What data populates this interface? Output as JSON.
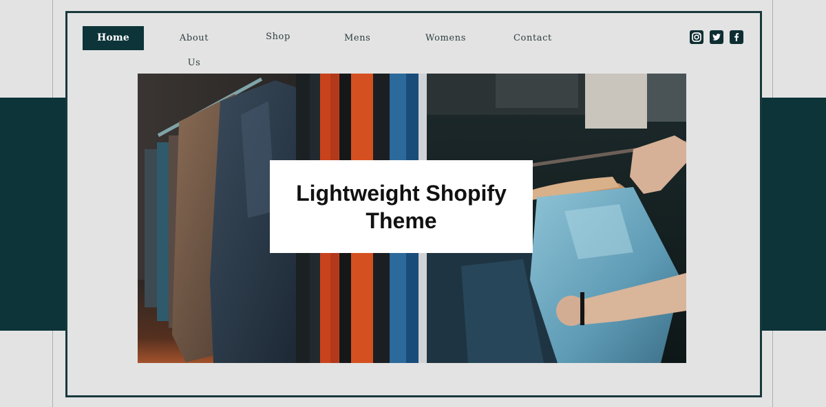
{
  "nav": {
    "items": [
      {
        "label": "Home",
        "active": true
      },
      {
        "label": "About Us",
        "active": false
      },
      {
        "label": "Shop",
        "active": false
      },
      {
        "label": "Mens",
        "active": false
      },
      {
        "label": "Womens",
        "active": false
      },
      {
        "label": "Contact",
        "active": false
      }
    ]
  },
  "social": {
    "icons": [
      "instagram-icon",
      "twitter-icon",
      "facebook-icon"
    ]
  },
  "hero": {
    "headline": "Lightweight Shopify Theme",
    "image": "clothing-rack-photo"
  },
  "colors": {
    "brand_dark": "#0c3439",
    "frame_border": "#17383c",
    "background": "#e3e3e3",
    "nav_text": "#2e3d3e"
  }
}
